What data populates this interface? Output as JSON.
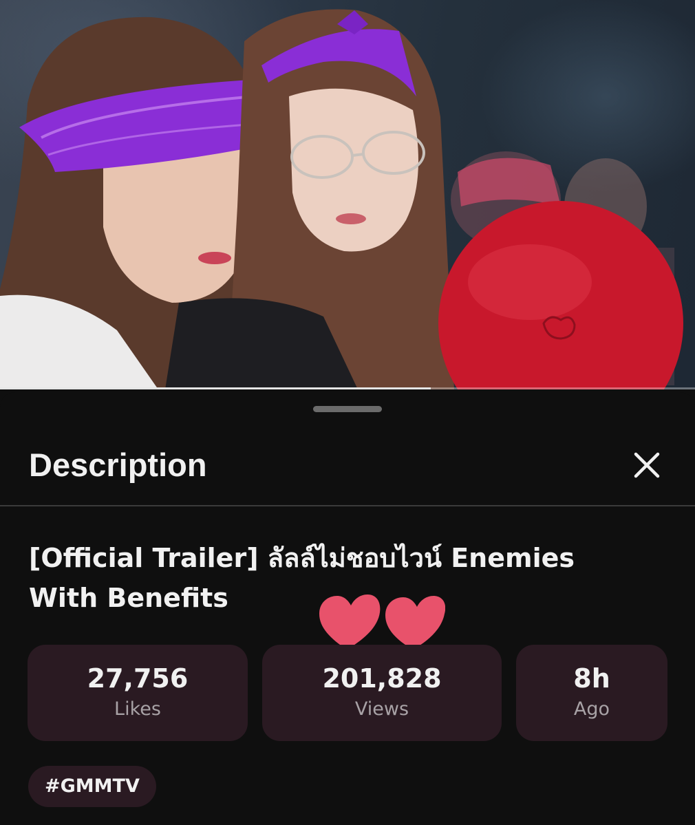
{
  "video": {
    "progress_fraction": 0.62
  },
  "sheet": {
    "title": "Description",
    "close_icon": "close-icon"
  },
  "description": {
    "video_title": "[Official Trailer] ลัลล์ไม่ชอบไวน์ Enemies With Benefits",
    "stats": [
      {
        "value": "27,756",
        "label": "Likes"
      },
      {
        "value": "201,828",
        "label": "Views"
      },
      {
        "value": "8h",
        "label": "Ago"
      }
    ],
    "hashtag": "#GMMTV"
  },
  "decorations": {
    "hearts_icon": "hearts-icon",
    "heart_color": "#e8526b"
  },
  "colors": {
    "background": "#0f0f0f",
    "card": "#2a1a22",
    "muted_text": "#a8a2a6"
  }
}
